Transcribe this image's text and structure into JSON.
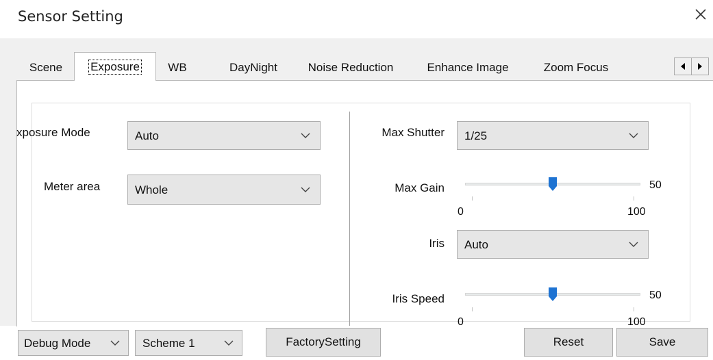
{
  "window": {
    "title": "Sensor Setting",
    "close_icon": "close-icon"
  },
  "tabs": [
    {
      "label": "Scene",
      "active": false
    },
    {
      "label": "Exposure",
      "active": true
    },
    {
      "label": "WB",
      "active": false
    },
    {
      "label": "DayNight",
      "active": false
    },
    {
      "label": "Noise Reduction",
      "active": false
    },
    {
      "label": "Enhance Image",
      "active": false
    },
    {
      "label": "Zoom Focus",
      "active": false
    }
  ],
  "tab_scroll": {
    "left_icon": "arrow-left-icon",
    "right_icon": "arrow-right-icon"
  },
  "exposure": {
    "left": {
      "exposure_mode": {
        "label": "xposure Mode",
        "value": "Auto"
      },
      "meter_area": {
        "label": "Meter area",
        "value": "Whole"
      }
    },
    "right": {
      "max_shutter": {
        "label": "Max Shutter",
        "value": "1/25"
      },
      "max_gain": {
        "label": "Max Gain",
        "value": 50,
        "value_text": "50",
        "min_text": "0",
        "max_text": "100"
      },
      "iris": {
        "label": "Iris",
        "value": "Auto"
      },
      "iris_speed": {
        "label": "Iris Speed",
        "value": 50,
        "value_text": "50",
        "min_text": "0",
        "max_text": "100"
      }
    }
  },
  "footer": {
    "debug_mode": "Debug Mode",
    "scheme": "Scheme 1",
    "factory_setting": "FactorySetting",
    "reset": "Reset",
    "save": "Save"
  },
  "colors": {
    "slider_thumb": "#1e73d2",
    "panel_bg": "#f0f0f0",
    "combo_bg": "#e6e6e6"
  }
}
